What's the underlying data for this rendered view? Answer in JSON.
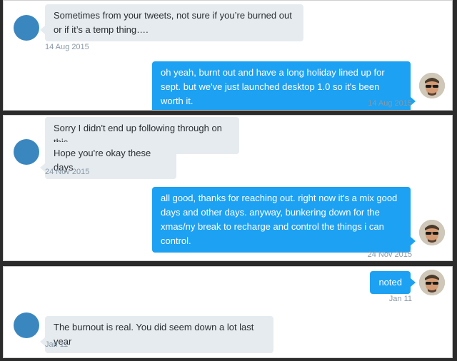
{
  "threads": [
    {
      "incoming": {
        "messages": [
          "Sometimes from your tweets, not sure if you’re burned out or if it’s a temp thing…."
        ],
        "date": "14 Aug 2015"
      },
      "outgoing": {
        "messages": [
          "oh yeah, burnt out and have a long holiday lined up for sept. but we've just launched desktop 1.0 so it's been worth it."
        ],
        "date": "14 Aug 2015"
      }
    },
    {
      "incoming": {
        "messages": [
          "Sorry I didn't end up following through on this",
          "Hope you're okay these days"
        ],
        "date": "24 Nov 2015"
      },
      "outgoing": {
        "messages": [
          "all good, thanks for reaching out. right now it's a mix good days and other days. anyway, bunkering down for the xmas/ny break to recharge and control the things i can control."
        ],
        "date": "24 Nov 2015"
      }
    },
    {
      "outgoing": {
        "messages": [
          "noted"
        ],
        "date": "Jan 11"
      },
      "incoming": {
        "messages": [
          "The burnout is real. You did seem down a lot last year"
        ],
        "date": "Jan 11"
      }
    }
  ],
  "colors": {
    "incoming_bubble": "#e6ebef",
    "outgoing_bubble": "#1da1f2",
    "avatar_default": "#3a87c0",
    "timestamp": "#8899a6"
  },
  "icons": {
    "contact_avatar": "default-avatar-circle",
    "user_avatar": "user-photo-sunglasses"
  }
}
